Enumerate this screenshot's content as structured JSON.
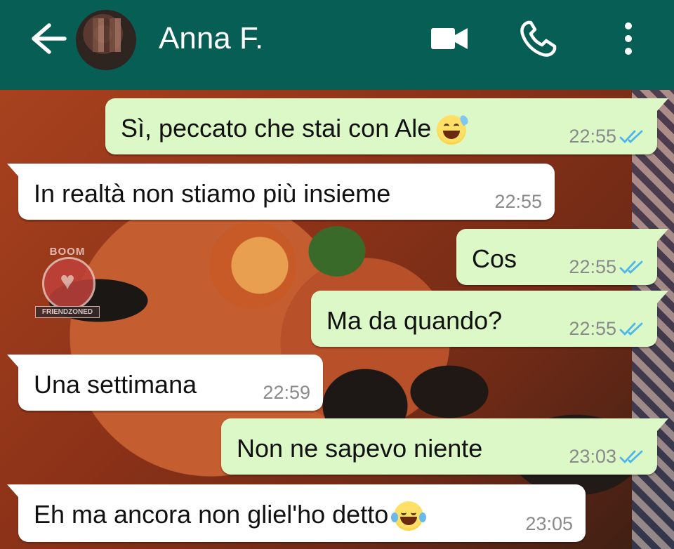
{
  "header": {
    "contact_name": "Anna F.",
    "icons": [
      "back-arrow-icon",
      "video-call-icon",
      "phone-icon",
      "more-options-icon"
    ],
    "background_color": "#075e54"
  },
  "watermark": {
    "top_text": "BOOM",
    "bottom_text": "FRIENDZONED"
  },
  "messages": [
    {
      "direction": "outgoing",
      "text": "Sì, peccato che stai con Ale",
      "emoji": "grinning-sweat-emoji",
      "time": "22:55",
      "status": "read"
    },
    {
      "direction": "incoming",
      "text": "In realtà non stiamo più insieme",
      "time": "22:55"
    },
    {
      "direction": "outgoing",
      "text": "Cos",
      "time": "22:55",
      "status": "read"
    },
    {
      "direction": "outgoing",
      "text": "Ma da quando?",
      "time": "22:55",
      "status": "read"
    },
    {
      "direction": "incoming",
      "text": "Una settimana",
      "time": "22:59"
    },
    {
      "direction": "outgoing",
      "text": "Non ne sapevo niente",
      "time": "23:03",
      "status": "read"
    },
    {
      "direction": "incoming",
      "text": "Eh ma ancora non gliel'ho detto",
      "emoji": "tears-of-joy-emoji",
      "time": "23:05"
    }
  ],
  "colors": {
    "outgoing_bubble": "#dcf8c6",
    "incoming_bubble": "#ffffff",
    "read_ticks": "#4fb6ec"
  }
}
